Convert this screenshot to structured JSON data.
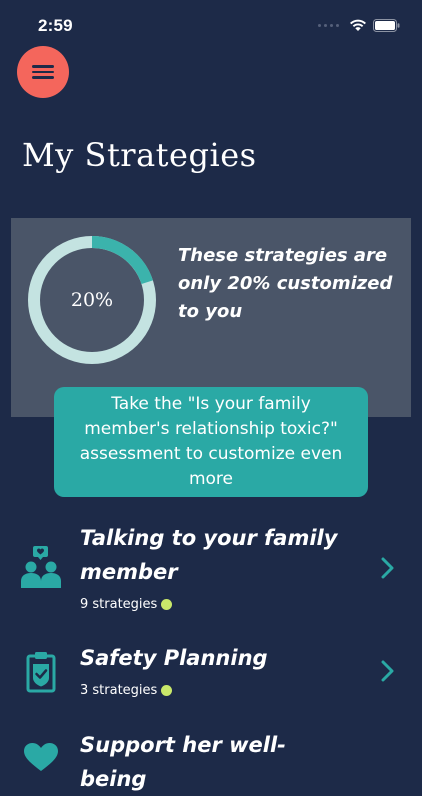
{
  "status_bar": {
    "time": "2:59",
    "icons": [
      "cellular-dots-icon",
      "wifi-icon",
      "battery-icon"
    ]
  },
  "header": {
    "menu_icon": "hamburger-icon",
    "title": "My Strategies"
  },
  "progress": {
    "percent": 20,
    "percent_label": "20%",
    "message": "These strategies are only 20% customized to you",
    "ring_color": "#3bb3ac",
    "track_color": "#c4e3e1"
  },
  "assessment": {
    "label": "Take the \"Is your family member's relationship toxic?\" assessment to customize even more"
  },
  "strategies": [
    {
      "title": "Talking to your family member",
      "count": "9 strategies",
      "icon": "family-chat-icon"
    },
    {
      "title": "Safety Planning",
      "count": "3 strategies",
      "icon": "clipboard-check-icon"
    },
    {
      "title": "Support her well-being",
      "icon": "heart-icon"
    }
  ],
  "colors": {
    "background": "#1d2a48",
    "accent": "#2aa9a5",
    "menu_button": "#f4665c",
    "status_dot": "#c9e86a",
    "card": "#4a5568"
  }
}
